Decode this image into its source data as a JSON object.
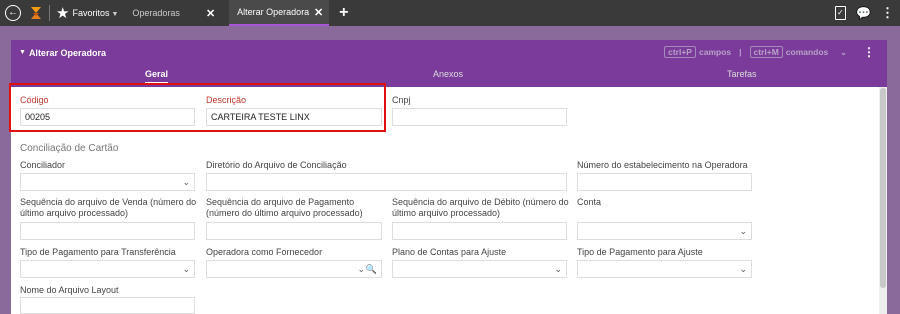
{
  "topbar": {
    "favorites_label": "Favoritos",
    "tabs": [
      {
        "label": "Operadoras"
      },
      {
        "label": "Alterar Operadora"
      }
    ],
    "close_glyph": "✕",
    "add_glyph": "+"
  },
  "panel": {
    "title": "Alterar Operadora",
    "shortcut_campos_key": "ctrl+P",
    "shortcut_campos_label": "campos",
    "shortcut_sep": "|",
    "shortcut_comandos_key": "ctrl+M",
    "shortcut_comandos_label": "comandos",
    "tabs": [
      {
        "label": "Geral"
      },
      {
        "label": "Anexos"
      },
      {
        "label": "Tarefas"
      }
    ]
  },
  "form": {
    "codigo": {
      "label": "Código",
      "value": "00205"
    },
    "descricao": {
      "label": "Descrição",
      "value": "CARTEIRA TESTE LINX"
    },
    "cnpj": {
      "label": "Cnpj",
      "value": ""
    },
    "section_title": "Conciliação de Cartão",
    "conciliador": {
      "label": "Conciliador",
      "value": ""
    },
    "diretorio": {
      "label": "Diretório do Arquivo de Conciliação",
      "value": ""
    },
    "numero_estab": {
      "label": "Número do estabelecimento na Operadora",
      "value": ""
    },
    "seq_venda": {
      "label": "Sequência do arquivo de Venda (número do último arquivo processado)",
      "value": ""
    },
    "seq_pagamento": {
      "label": "Sequência do arquivo de Pagamento (número do último arquivo processado)",
      "value": ""
    },
    "seq_debito": {
      "label": "Sequência do arquivo de Débito (número do último arquivo processado)",
      "value": ""
    },
    "conta": {
      "label": "Conta",
      "value": ""
    },
    "tipo_pag_transf": {
      "label": "Tipo de Pagamento para Transferência",
      "value": ""
    },
    "operadora_fornecedor": {
      "label": "Operadora como Fornecedor",
      "value": ""
    },
    "plano_contas": {
      "label": "Plano de Contas para Ajuste",
      "value": ""
    },
    "tipo_pag_ajuste": {
      "label": "Tipo de Pagamento para Ajuste",
      "value": ""
    },
    "nome_layout": {
      "label": "Nome do Arquivo Layout",
      "value": ""
    }
  },
  "colors": {
    "accent": "#7a3b9a",
    "topbar": "#3a3a3a",
    "required_label": "#c0392b",
    "highlight_border": "#e01010"
  },
  "icons": [
    "back-icon",
    "logo-icon",
    "star-icon",
    "close-icon",
    "add-icon",
    "clipboard-check-icon",
    "chat-icon",
    "more-vertical-icon",
    "chevron-down-icon",
    "search-icon"
  ]
}
